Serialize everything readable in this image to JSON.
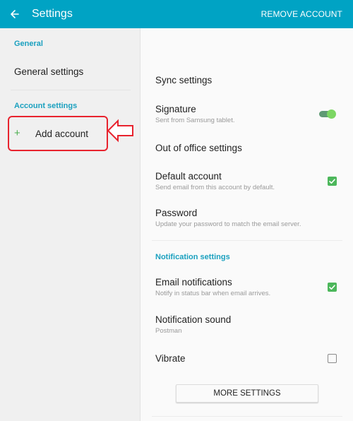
{
  "header": {
    "back_icon": "arrow-left-icon",
    "title": "Settings",
    "action_label": "REMOVE ACCOUNT",
    "color": "#00a3c4"
  },
  "sidebar": {
    "sections": [
      {
        "label": "General",
        "items": [
          {
            "label": "General settings"
          }
        ]
      },
      {
        "label": "Account settings",
        "items": [
          {
            "label": "Add account",
            "icon": "plus-icon"
          }
        ]
      }
    ]
  },
  "annotation": {
    "highlight_target": "Add account",
    "color": "#e8232e",
    "icon": "left-arrow-icon"
  },
  "content": {
    "rows": [
      {
        "title": "Sync settings"
      },
      {
        "title": "Signature",
        "subtitle": "Sent from Samsung tablet.",
        "control": "toggle",
        "state": "on"
      },
      {
        "title": "Out of office settings"
      },
      {
        "title": "Default account",
        "subtitle": "Send email from this account by default.",
        "control": "checkbox",
        "state": "checked"
      },
      {
        "title": "Password",
        "subtitle": "Update your password to match the email server."
      }
    ],
    "notification_section": {
      "label": "Notification settings",
      "rows": [
        {
          "title": "Email notifications",
          "subtitle": "Notify in status bar when email arrives.",
          "control": "checkbox",
          "state": "checked"
        },
        {
          "title": "Notification sound",
          "subtitle": "Postman"
        },
        {
          "title": "Vibrate",
          "control": "checkbox",
          "state": "unchecked"
        }
      ]
    },
    "more_button_label": "MORE SETTINGS"
  },
  "colors": {
    "accent": "#1aa0bf",
    "check_on": "#4cb75b",
    "toggle_thumb": "#7cd663"
  }
}
